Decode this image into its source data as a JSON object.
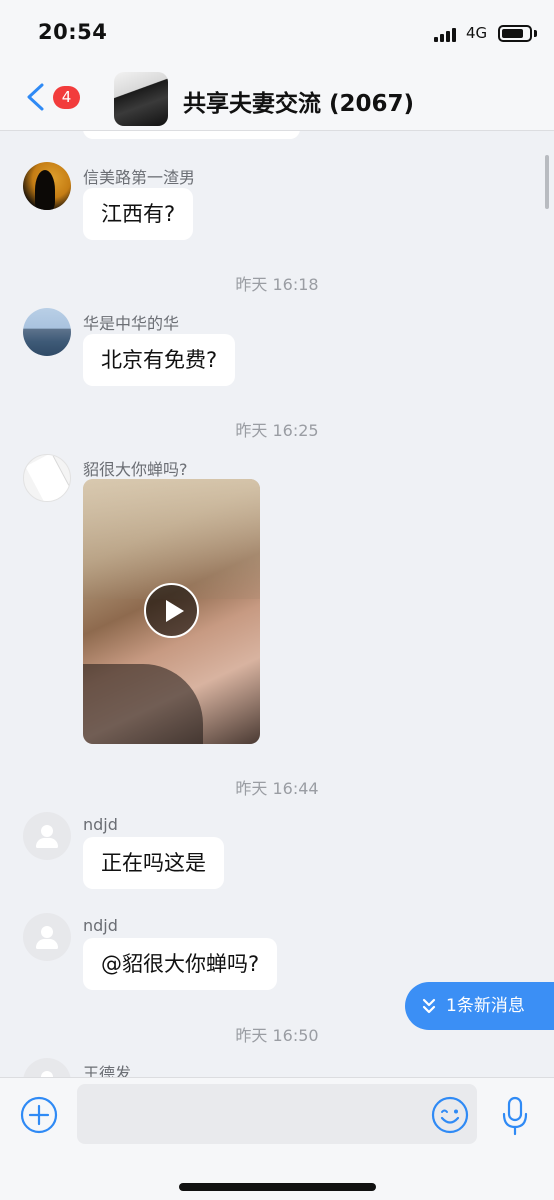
{
  "status_bar": {
    "time": "20:54",
    "network": "4G"
  },
  "header": {
    "unread_count": "4",
    "title": "共享夫妻交流 (2067)"
  },
  "messages": [
    {
      "sender": "信美路第一渣男",
      "text": "江西有?"
    },
    {
      "timestamp": "昨天 16:18"
    },
    {
      "sender": "华是中华的华",
      "text": "北京有免费?"
    },
    {
      "timestamp": "昨天 16:25"
    },
    {
      "sender": "貂很大你蝉吗?",
      "type": "video"
    },
    {
      "timestamp": "昨天 16:44"
    },
    {
      "sender": "ndjd",
      "text": "正在吗这是"
    },
    {
      "sender": "ndjd",
      "text": "@貂很大你蝉吗?"
    },
    {
      "timestamp": "昨天 16:50"
    },
    {
      "sender": "王德发"
    }
  ],
  "new_message_pill": "1条新消息",
  "input": {
    "placeholder": ""
  },
  "icons": [
    "back-icon",
    "plus-icon",
    "emoji-icon",
    "mic-icon",
    "play-icon",
    "double-chevron-down-icon"
  ],
  "colors": {
    "accent": "#3b8ff5",
    "badge": "#f23c3c"
  }
}
